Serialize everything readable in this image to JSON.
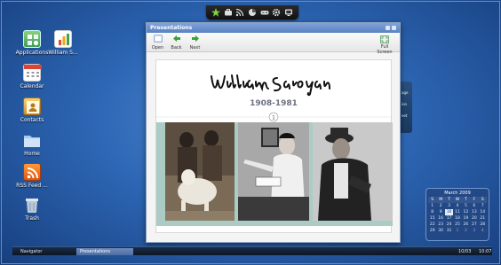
{
  "desktop": {
    "icons": [
      {
        "label": "Applications"
      },
      {
        "label": "William S..."
      },
      {
        "label": "Calendar"
      },
      {
        "label": "Contacts"
      },
      {
        "label": "Home"
      },
      {
        "label": "RSS Feed ..."
      },
      {
        "label": "Trash"
      }
    ]
  },
  "top_dock": {
    "icons": [
      "star-icon",
      "briefcase-icon",
      "rss-icon",
      "pie-icon",
      "gamepad-icon",
      "gear-icon",
      "tv-icon"
    ]
  },
  "window": {
    "title": "Presentations",
    "toolbar": {
      "open_label": "Open",
      "back_label": "Back",
      "next_label": "Next",
      "fullscreen_label": "Full Screen"
    },
    "slide": {
      "signature_text": "William Saroyan",
      "years": "1908-1981"
    }
  },
  "calendar": {
    "title": "March 2009",
    "weekdays": [
      "S",
      "M",
      "T",
      "W",
      "T",
      "F",
      "S"
    ],
    "weeks": [
      [
        "1",
        "2",
        "3",
        "4",
        "5",
        "6",
        "7"
      ],
      [
        "8",
        "9",
        "10",
        "11",
        "12",
        "13",
        "14"
      ],
      [
        "15",
        "16",
        "17",
        "18",
        "19",
        "20",
        "21"
      ],
      [
        "22",
        "23",
        "24",
        "25",
        "26",
        "27",
        "28"
      ],
      [
        "29",
        "30",
        "31",
        "1",
        "2",
        "3",
        "4"
      ]
    ],
    "today": "10"
  },
  "taskbar": {
    "navigator_label": "Navigator",
    "task_label": "Presentations",
    "date": "10/03",
    "time": "10:07"
  },
  "colors": {
    "desktop_accent": "#2d66b4",
    "title_bar": "#5a82c2",
    "photo_strip": "#aaccc4"
  }
}
